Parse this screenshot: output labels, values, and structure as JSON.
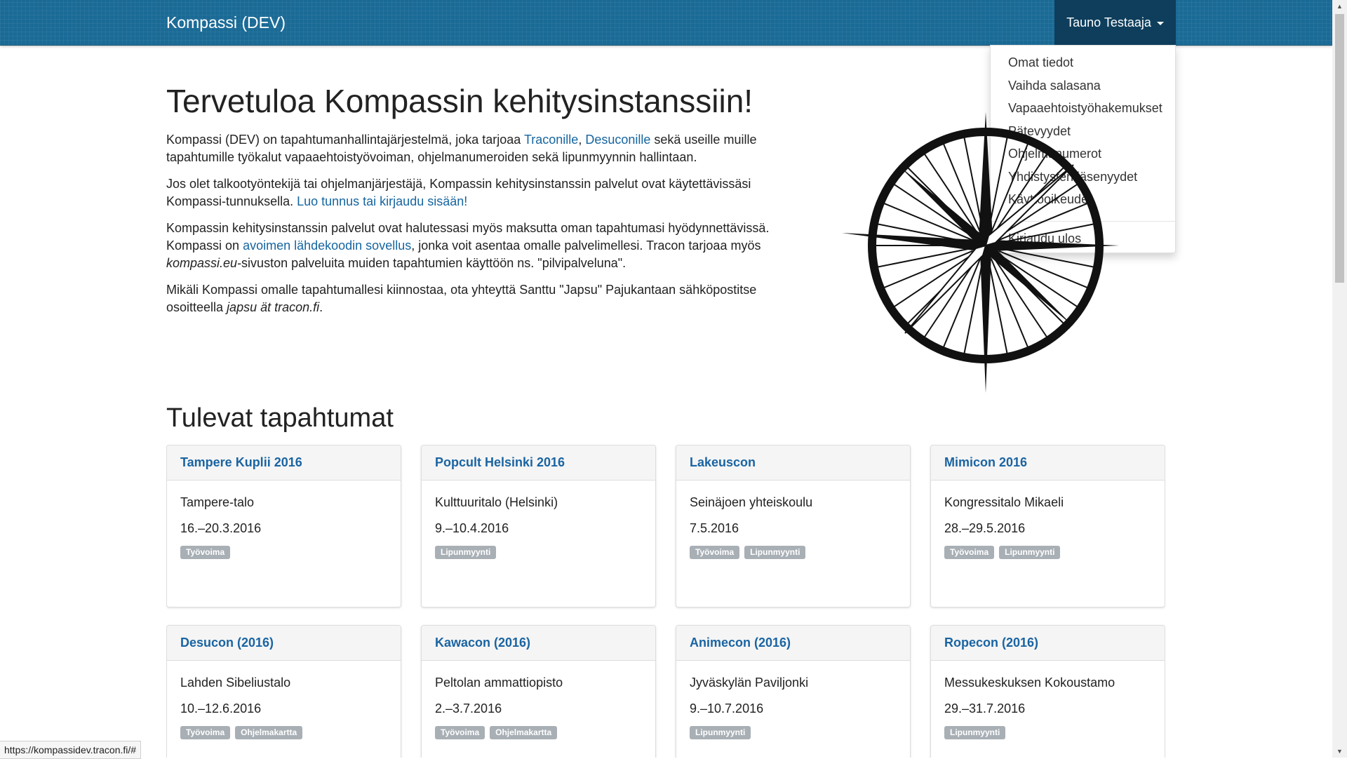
{
  "navbar": {
    "brand": "Kompassi (DEV)",
    "user": "Tauno Testaaja",
    "accent": "#1a6a96"
  },
  "dropdown": {
    "items": [
      "Omat tiedot",
      "Vaihda salasana",
      "Vapaaehtoistyöhakemukset",
      "Pätevyydet",
      "Ohjelmanumerot",
      "Yhdistysten jäsenyydet",
      "Käyttöoikeudet"
    ],
    "logout": "Kirjaudu ulos"
  },
  "hero": {
    "title": "Tervetuloa Kompassin kehitysinstanssiin!",
    "p1": {
      "a": "Kompassi (DEV) on tapahtumanhallintajärjestelmä, joka tarjoaa ",
      "link1": "Traconille",
      "sep": ", ",
      "link2": "Desuconille",
      "b": " sekä useille muille tapahtumille työkalut vapaaehtoistyövoiman, ohjelmanumeroiden sekä lipunmyynnin hallintaan."
    },
    "p2": {
      "a": "Jos olet talkootyöntekijä tai ohjelmanjärjestäjä, Kompassin kehitysinstanssin palvelut ovat käytettävissäsi Kompassi-tunnuksella. ",
      "link": "Luo tunnus tai kirjaudu sisään!"
    },
    "p3": {
      "a": "Kompassin kehitysinstanssin palvelut ovat halutessasi myös maksutta oman tapahtumasi hyödynnettävissä. Kompassi on ",
      "link": "avoimen lähdekoodin sovellus",
      "b": ", jonka voit asentaa omalle palvelimellesi. Tracon tarjoaa myös ",
      "em": "kompassi.eu",
      "c": "-sivuston palveluita muiden tapahtumien käyttöön ns. \"pilvipalveluna\"."
    },
    "p4": {
      "a": "Mikäli Kompassi omalle tapahtumallesi kiinnostaa, ota yhteyttä Santtu \"Japsu\" Pajukantaan sähköpostitse osoitteella ",
      "em": "japsu ät tracon.fi",
      "b": "."
    }
  },
  "events": {
    "title": "Tulevat tapahtumat",
    "items": [
      {
        "name": "Tampere Kuplii 2016",
        "venue": "Tampere-talo",
        "dates": "16.–20.3.2016",
        "tags": [
          "Työvoima"
        ]
      },
      {
        "name": "Popcult Helsinki 2016",
        "venue": "Kulttuuritalo (Helsinki)",
        "dates": "9.–10.4.2016",
        "tags": [
          "Lipunmyynti"
        ]
      },
      {
        "name": "Lakeuscon",
        "venue": "Seinäjoen yhteiskoulu",
        "dates": "7.5.2016",
        "tags": [
          "Työvoima",
          "Lipunmyynti"
        ]
      },
      {
        "name": "Mimicon 2016",
        "venue": "Kongressitalo Mikaeli",
        "dates": "28.–29.5.2016",
        "tags": [
          "Työvoima",
          "Lipunmyynti"
        ]
      },
      {
        "name": "Desucon (2016)",
        "venue": "Lahden Sibeliustalo",
        "dates": "10.–12.6.2016",
        "tags": [
          "Työvoima",
          "Ohjelmakartta"
        ]
      },
      {
        "name": "Kawacon (2016)",
        "venue": "Peltolan ammattiopisto",
        "dates": "2.–3.7.2016",
        "tags": [
          "Työvoima",
          "Ohjelmakartta"
        ]
      },
      {
        "name": "Animecon (2016)",
        "venue": "Jyväskylän Paviljonki",
        "dates": "9.–10.7.2016",
        "tags": [
          "Lipunmyynti"
        ]
      },
      {
        "name": "Ropecon (2016)",
        "venue": "Messukeskuksen Kokoustamo",
        "dates": "29.–31.7.2016",
        "tags": [
          "Lipunmyynti"
        ]
      }
    ]
  },
  "status": {
    "url": "https://kompassidev.tracon.fi/#"
  },
  "icons": {
    "caret": "caret-down-icon",
    "compass": "compass-rose-icon"
  }
}
